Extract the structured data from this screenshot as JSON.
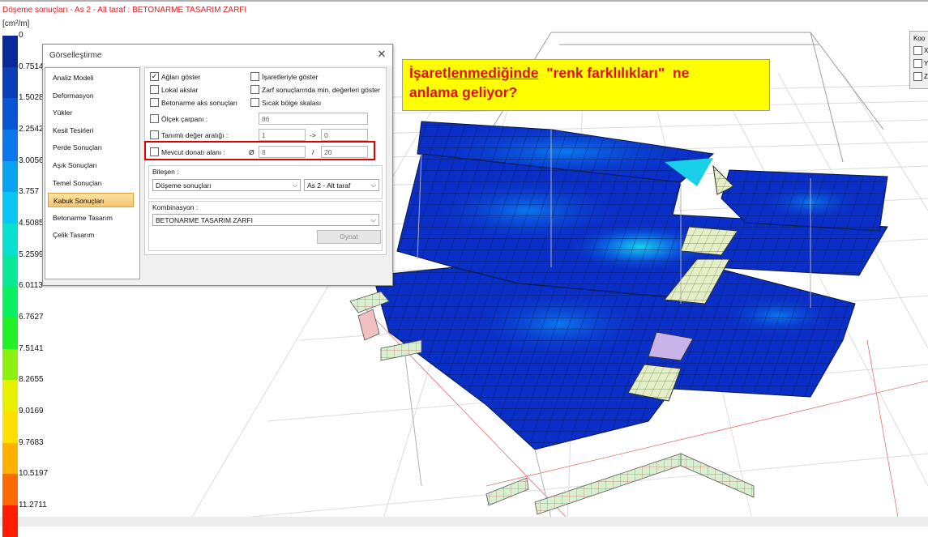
{
  "window": {
    "title": "Döşeme sonuçları - As 2 - Alt taraf : BETONARME TASARIM ZARFI",
    "unit": "[cm²/m]"
  },
  "legend": {
    "labels": [
      "0",
      "0.7514",
      "1.5028",
      "2.2542",
      "3.0056",
      "3.757",
      "4.5085",
      "5.2599",
      "6.0113",
      "6.7627",
      "7.5141",
      "8.2655",
      "9.0169",
      "9.7683",
      "10.5197",
      "11.2711"
    ],
    "colors": [
      "#0a2a9a",
      "#0a3fb8",
      "#0a55d6",
      "#0a77ea",
      "#0aa3f0",
      "#0ac6f2",
      "#0ae0d0",
      "#0ae89a",
      "#0af060",
      "#24f028",
      "#8ef010",
      "#e6f000",
      "#ffe000",
      "#ffb000",
      "#ff6a00",
      "#ff1c00"
    ]
  },
  "dialog": {
    "title": "Görselleştirme",
    "close_icon": "close-icon",
    "nav": [
      "Analiz Modeli",
      "Deformasyon",
      "Yükler",
      "Kesit Tesirleri",
      "Perde Sonuçları",
      "Aşık Sonuçları",
      "Temel Sonuçları",
      "Kabuk Sonuçları",
      "Betonarme Tasarım",
      "Çelik Tasarım"
    ],
    "nav_selected": "Kabuk Sonuçları",
    "options": {
      "aglari_goster": {
        "label": "Ağları göster",
        "checked": true
      },
      "lokal_akslar": {
        "label": "Lokal akslar",
        "checked": false
      },
      "betonarme_aks": {
        "label": "Betonarme aks sonuçları",
        "checked": false
      },
      "isaretleriyle": {
        "label": "İşaretleriyle göster",
        "checked": false
      },
      "zarf_min": {
        "label": "Zarf sonuçlarında min. değerleri göster",
        "checked": false
      },
      "sicak_bolge": {
        "label": "Sıcak bölge skalası",
        "checked": false
      },
      "olcek": {
        "label": "Ölçek çarpanı :",
        "checked": false,
        "value": "86"
      },
      "tanimli": {
        "label": "Tanımlı değer aralığı :",
        "checked": false,
        "from": "1",
        "arrow": "->",
        "to": "0"
      },
      "mevcut": {
        "label": "Mevcut donatı alanı :",
        "checked": false,
        "phi": "Ø",
        "dia": "8",
        "slash": "/",
        "spacing": "20"
      }
    },
    "bilesen": {
      "label": "Bileşen :",
      "value": "Döşeme sonuçları",
      "side": "As 2 - Alt taraf"
    },
    "kombinasyon": {
      "label": "Kombinasyon :",
      "value": "BETONARME TASARIM ZARFI"
    },
    "play_button": "Oynat"
  },
  "annotation": {
    "line1_prefix": "İşaret",
    "line1_underlined": "lenmediğinde",
    "line1_suffix": "  \"renk farklılıkları\"  ne",
    "line2": "anlama geliyor?"
  },
  "axes_panel": {
    "header": "Koo",
    "rows": [
      "X",
      "Y",
      "Z"
    ]
  }
}
